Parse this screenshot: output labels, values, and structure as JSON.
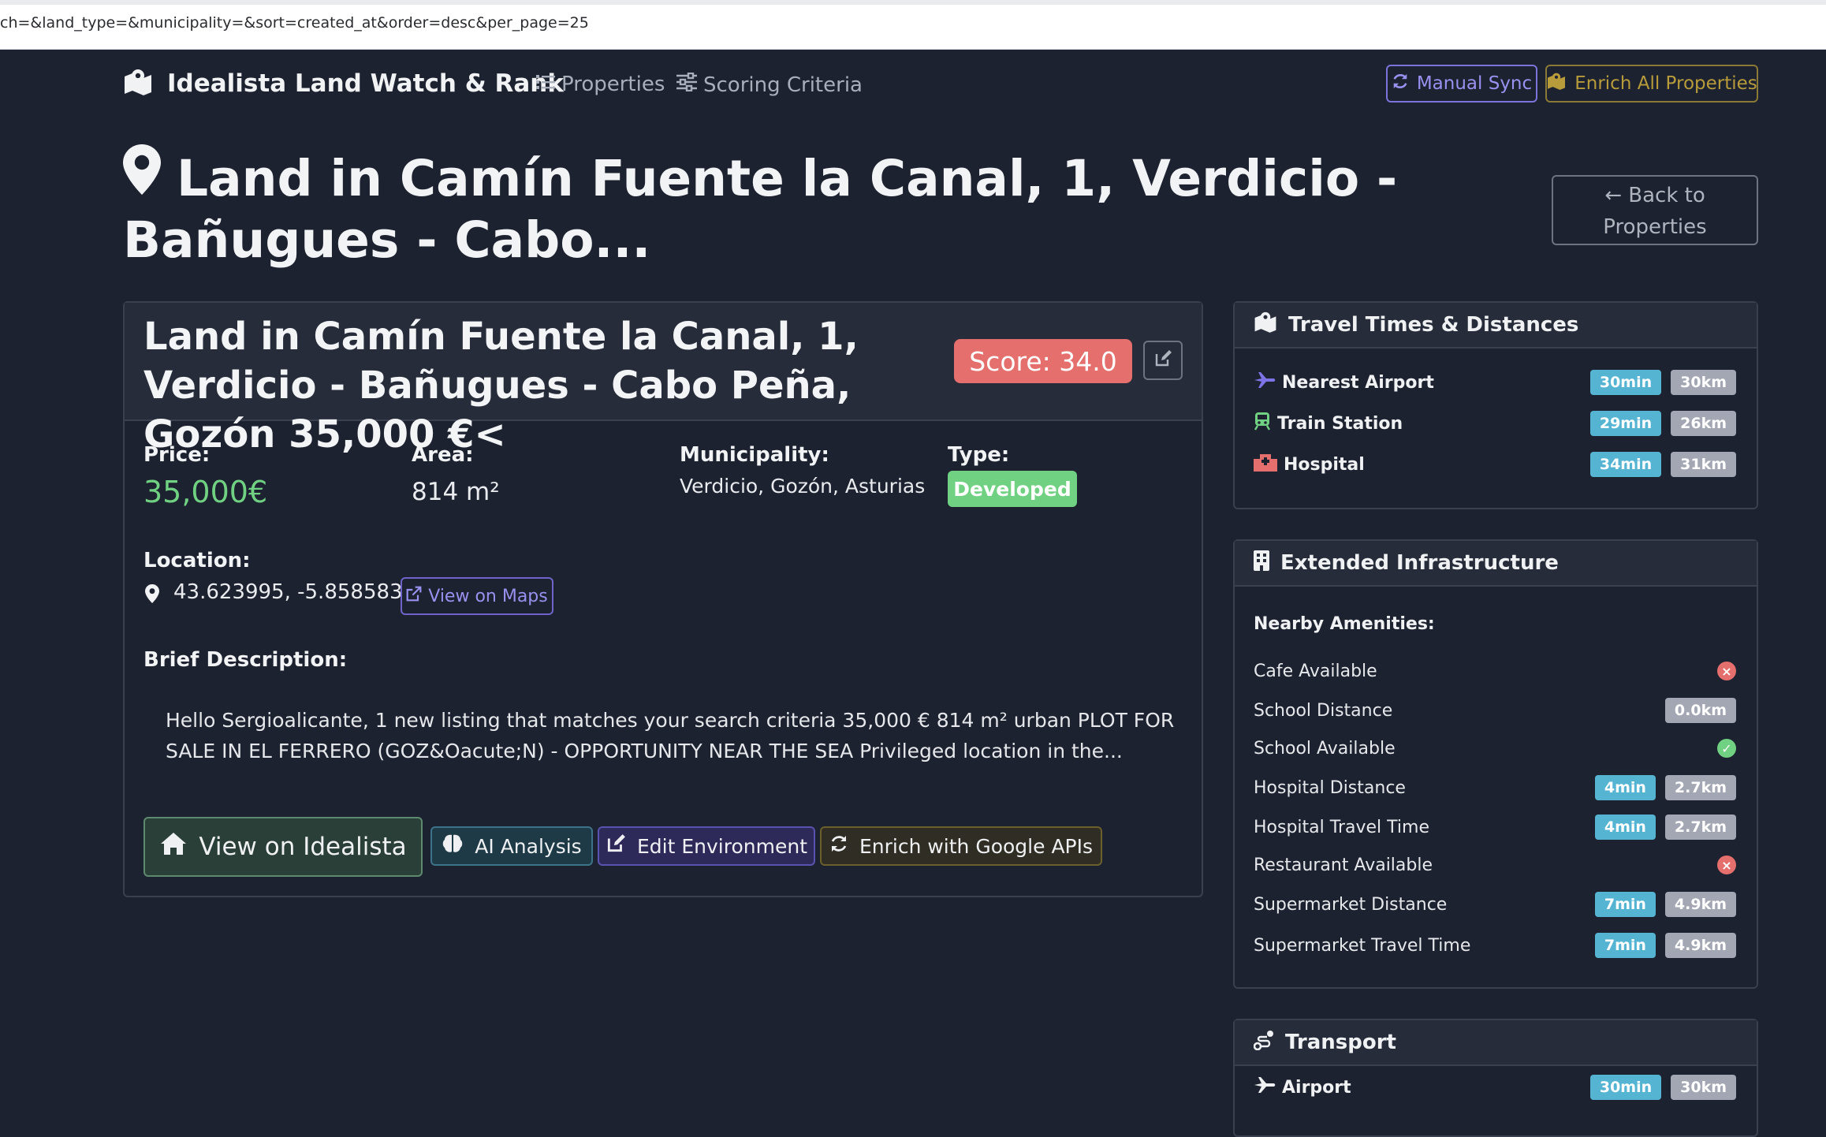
{
  "browser": {
    "url": "ch=&land_type=&municipality=&sort=created_at&order=desc&per_page=25"
  },
  "navbar": {
    "brand": "Idealista Land Watch & Rank",
    "links": [
      {
        "label": "Properties",
        "icon": "list-icon"
      },
      {
        "label": "Scoring Criteria",
        "icon": "sliders-icon"
      }
    ],
    "manual_sync": "Manual Sync",
    "enrich_all": "Enrich All Properties"
  },
  "page": {
    "title": "Land in Camín Fuente la Canal, 1, Verdicio - Bañugues - Cabo...",
    "back_button": "Back to Properties"
  },
  "property": {
    "title": "Land in Camín Fuente la Canal, 1, Verdicio - Bañugues - Cabo Peña, Gozón 35,000 €<",
    "score": "Score: 34.0",
    "price_label": "Price:",
    "price": "35,000€",
    "area_label": "Area:",
    "area": "814 m²",
    "municipality_label": "Municipality:",
    "municipality": "Verdicio, Gozón, Asturias",
    "type_label": "Type:",
    "type": "Developed",
    "location_label": "Location:",
    "coordinates": "43.623995, -5.858583",
    "view_on_maps": "View on Maps",
    "description_label": "Brief Description:",
    "description": "Hello Sergioalicante, 1 new listing that matches your search criteria 35,000 € 814 m² urban PLOT FOR SALE IN EL FERRERO (GOZ&Oacute;N) - OPPORTUNITY NEAR THE SEA Privileged location in the...",
    "actions": {
      "view_idealista": "View on Idealista",
      "ai_analysis": "AI Analysis",
      "edit_environment": "Edit Environment",
      "enrich_google": "Enrich with Google APIs"
    }
  },
  "travel": {
    "title": "Travel Times & Distances",
    "items": [
      {
        "label": "Nearest Airport",
        "time": "30min",
        "dist": "30km",
        "icon": "plane-icon"
      },
      {
        "label": "Train Station",
        "time": "29min",
        "dist": "26km",
        "icon": "train-icon"
      },
      {
        "label": "Hospital",
        "time": "34min",
        "dist": "31km",
        "icon": "hospital-icon"
      }
    ]
  },
  "infrastructure": {
    "title": "Extended Infrastructure",
    "subtitle": "Nearby Amenities:",
    "rows": {
      "cafe": {
        "label": "Cafe Available"
      },
      "school_dist": {
        "label": "School Distance",
        "dist": "0.0km"
      },
      "school": {
        "label": "School Available"
      },
      "hosp_dist": {
        "label": "Hospital Distance",
        "time": "4min",
        "dist": "2.7km"
      },
      "hosp_time": {
        "label": "Hospital Travel Time",
        "time": "4min",
        "dist": "2.7km"
      },
      "restaurant": {
        "label": "Restaurant Available"
      },
      "super_dist": {
        "label": "Supermarket Distance",
        "time": "7min",
        "dist": "4.9km"
      },
      "super_time": {
        "label": "Supermarket Travel Time",
        "time": "7min",
        "dist": "4.9km"
      }
    }
  },
  "transport": {
    "title": "Transport",
    "airport": {
      "label": "Airport",
      "time": "30min",
      "dist": "30km"
    }
  },
  "colors": {
    "background": "#1d2230",
    "accent_purple": "#8f86ee",
    "score_red": "#e46f6c",
    "success_green": "#6fd181",
    "info_blue": "#56b4d3"
  }
}
